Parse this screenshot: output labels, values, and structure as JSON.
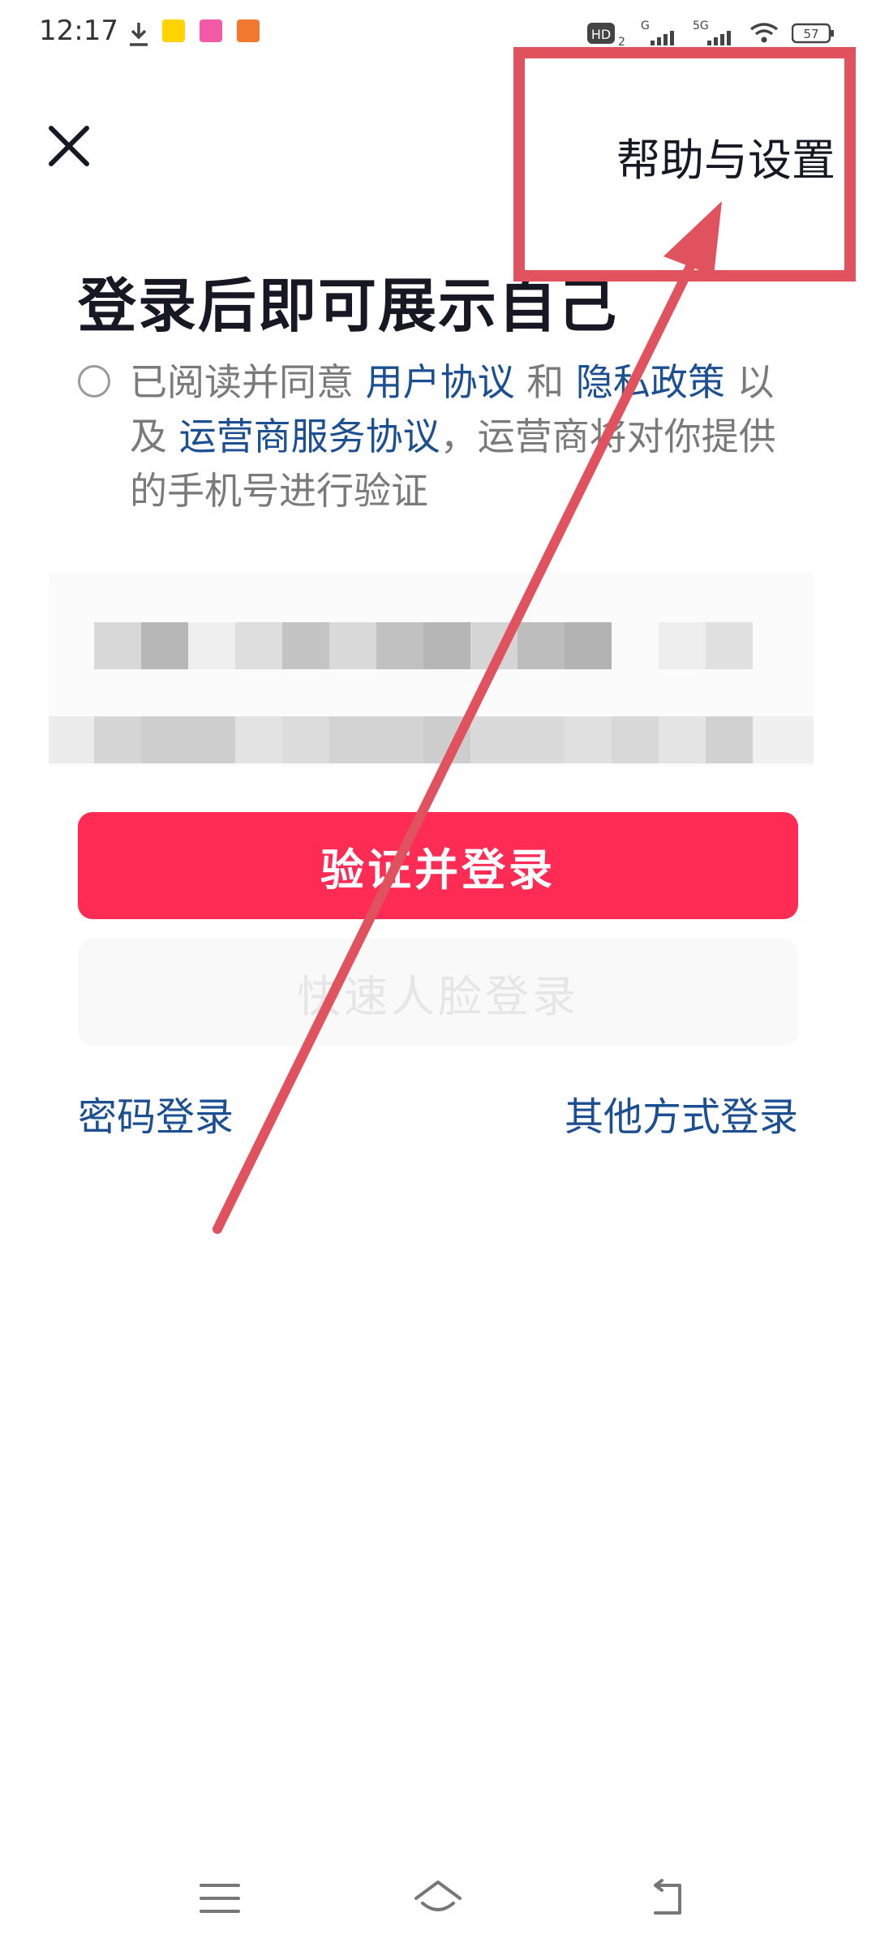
{
  "status_bar": {
    "time": "12:17",
    "network_label": "HD",
    "battery": "57",
    "icons": [
      "download-icon",
      "app-notification-icon",
      "app-notification-icon",
      "app-notification-icon",
      "hd-icon",
      "signal-g-icon",
      "signal-5g-icon",
      "wifi-icon",
      "battery-icon"
    ]
  },
  "header": {
    "close_icon": "close-icon",
    "help_settings": "帮助与设置"
  },
  "title": "登录后即可展示自己",
  "agreement": {
    "prefix": "已阅读并同意",
    "user_agreement": "用户协议",
    "and": "和",
    "privacy_policy": "隐私政策",
    "also": "以及",
    "carrier_agreement": "运营商服务协议",
    "suffix": "，运营商将对你提供的手机号进行验证"
  },
  "buttons": {
    "verify_login": "验证并登录",
    "face_login": "快速人脸登录",
    "password_login": "密码登录",
    "other_login": "其他方式登录"
  },
  "colors": {
    "primary": "#fe2c55",
    "link": "#1c4f91",
    "annotation": "#e0525e"
  },
  "nav_bar": {
    "icons": [
      "menu-icon",
      "home-icon",
      "back-icon"
    ]
  }
}
